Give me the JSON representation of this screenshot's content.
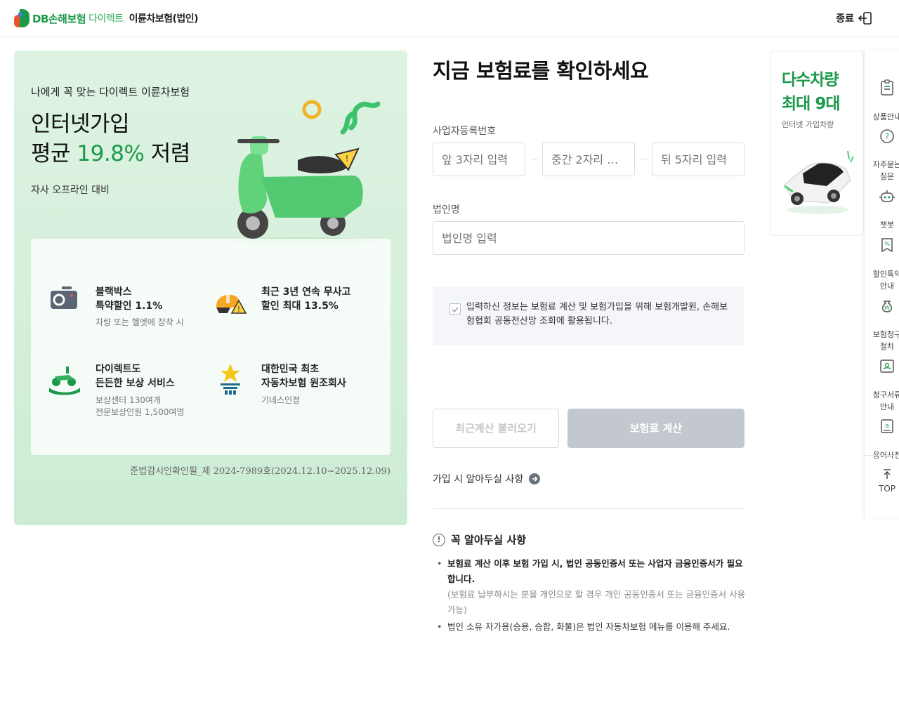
{
  "header": {
    "brand": "DB손해보험",
    "direct": "다이렉트",
    "product": "이륜차보험(법인)",
    "exit_label": "종료"
  },
  "promo": {
    "subtitle": "나에게 꼭 맞는 다이렉트 이륜차보험",
    "headline_line1": "인터넷가입",
    "headline_prefix": "평균 ",
    "headline_pct": "19.8%",
    "headline_suffix": " 저렴",
    "note": "자사 오프라인 대비",
    "benefits": [
      {
        "title": "블랙박스\n특약할인 1.1%",
        "desc": "차량 또는 헬멧에 장착 시"
      },
      {
        "title": "최근 3년 연속 무사고\n할인 최대 13.5%",
        "desc": ""
      },
      {
        "title": "다이렉트도\n든든한 보상 서비스",
        "desc": "보상센터 130여개\n전문보상인원 1,500여명"
      },
      {
        "title": "대한민국 최초\n자동차보험 원조회사",
        "desc": "기네스인정"
      }
    ],
    "footer": "준법감시인확인필_제 2024-7989호(2024.12.10~2025.12.09)"
  },
  "form": {
    "title": "지금 보험료를 확인하세요",
    "biz_label": "사업자등록번호",
    "biz_placeholders": [
      "앞 3자리 입력",
      "중간 2자리 …",
      "뒤 5자리 입력"
    ],
    "corp_label": "법인명",
    "corp_placeholder": "법인명 입력",
    "consent_text": "입력하신 정보는 보험료 계산 및 보험가입을 위해 보험개발원, 손해보험협회 공동전산망 조회에 활용됩니다.",
    "consent_checked": true,
    "recent_button": "최근계산 불러오기",
    "calc_button": "보험료 계산",
    "know_link": "가입 시 알아두실 사항",
    "must_title": "꼭 알아두실 사항",
    "must_items": {
      "item1_bold": "보험료 계산 이후 보험 가입 시, 법인 공동인증서 또는 사업자 금융인증서가 필요합니다.",
      "item1_sub": "(보험료 납부하시는 분을 개인으로 할 경우 개인 공동인증서 또는 금융인증서 사용 가능)",
      "item2": "법인 소유 자가용(승용, 승합, 화물)은 법인 자동차보험 메뉴를 이용해 주세요."
    }
  },
  "ad": {
    "title_line1": "다수차량",
    "title_line2": "최대 9대",
    "sub": "인터넷 가입차량"
  },
  "quick_menu": {
    "items": [
      {
        "label": "상품안내",
        "icon": "document-icon"
      },
      {
        "label": "자주묻는\n질문",
        "icon": "question-icon"
      },
      {
        "label": "챗봇",
        "icon": "robot-icon"
      },
      {
        "label": "할인특약\n안내",
        "icon": "discount-icon"
      },
      {
        "label": "보험청구\n절차",
        "icon": "moneybag-icon"
      },
      {
        "label": "청구서류\n안내",
        "icon": "id-card-icon"
      },
      {
        "label": "용어사전",
        "icon": "dictionary-icon"
      }
    ],
    "top_label": "TOP"
  },
  "colors": {
    "brand_green": "#1c9a4a",
    "promo_bg": "#d8f1dd",
    "button_disabled": "#c3c8cf"
  }
}
